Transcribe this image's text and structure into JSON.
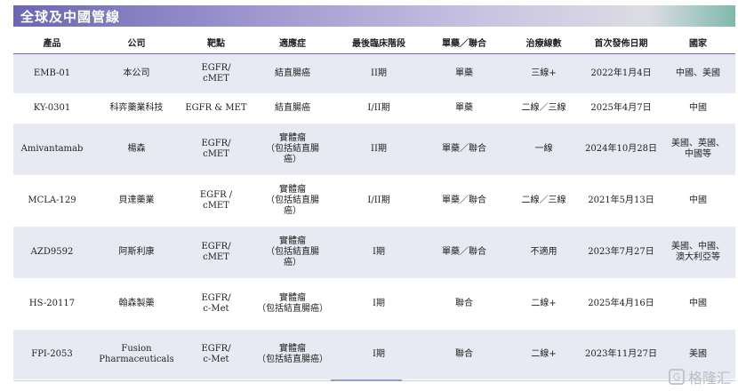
{
  "title": "全球及中國管線",
  "columns": [
    "產品",
    "公司",
    "靶點",
    "適應症",
    "最後臨床階段",
    "單藥／聯合",
    "治療線數",
    "首次發佈日期",
    "國家"
  ],
  "rows": [
    {
      "product": "EMB-01",
      "company": "本公司",
      "target": "EGFR/\ncMET",
      "indication": "結直腸癌",
      "stage": "II期",
      "mode": "單藥",
      "line": "三線+",
      "date": "2022年1月4日",
      "country": "中國、美國"
    },
    {
      "product": "KY-0301",
      "company": "科弈藥業科技",
      "target": "EGFR & MET",
      "indication": "結直腸癌",
      "stage": "I/II期",
      "mode": "單藥",
      "line": "二線／三線",
      "date": "2025年4月7日",
      "country": "中國"
    },
    {
      "product": "Amivantamab",
      "company": "楊森",
      "target": "EGFR/\ncMET",
      "indication": "實體瘤\n（包括結直腸\n癌）",
      "stage": "II期",
      "mode": "單藥／聯合",
      "line": "一線",
      "date": "2024年10月28日",
      "country": "美國、英國、\n中國等"
    },
    {
      "product": "MCLA-129",
      "company": "貝達藥業",
      "target": "EGFR /\ncMET",
      "indication": "實體瘤\n（包括結直腸\n癌）",
      "stage": "I/II期",
      "mode": "單藥／聯合",
      "line": "二線／三線",
      "date": "2021年5月13日",
      "country": "中國"
    },
    {
      "product": "AZD9592",
      "company": "阿斯利康",
      "target": "EGFR/\ncMET",
      "indication": "實體瘤\n（包括結直腸\n癌）",
      "stage": "I期",
      "mode": "單藥／聯合",
      "line": "不適用",
      "date": "2023年7月27日",
      "country": "美國、中國、\n澳大利亞等"
    },
    {
      "product": "HS-20117",
      "company": "翰森製藥",
      "target": "EGFR/\nc-Met",
      "indication": "實體瘤\n（包括結直腸癌）",
      "stage": "I期",
      "mode": "聯合",
      "line": "二線+",
      "date": "2025年4月16日",
      "country": "中國"
    },
    {
      "product": "FPI-2053",
      "company": "Fusion\nPharmaceuticals",
      "target": "EGFR/\nc-Met",
      "indication": "實體瘤\n（包括結直腸癌）",
      "stage": "I期",
      "mode": "聯合",
      "line": "二線+",
      "date": "2023年11月27日",
      "country": "美國"
    }
  ],
  "watermark": "格隆汇"
}
